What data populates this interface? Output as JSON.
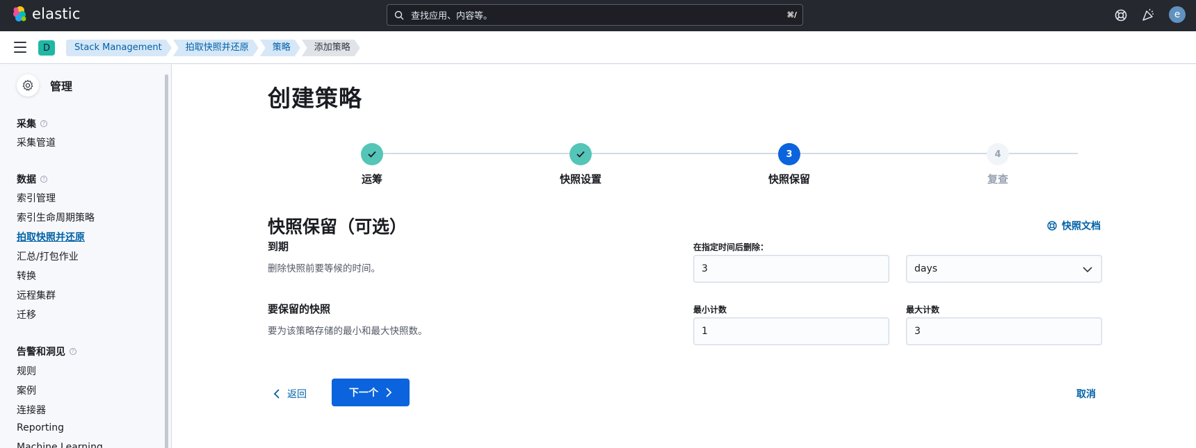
{
  "header": {
    "brand": "elastic",
    "search_placeholder": "查找应用、内容等。",
    "search_shortcut": "⌘/",
    "user_initial": "e"
  },
  "subbar": {
    "space_initial": "D",
    "breadcrumbs": [
      "Stack Management",
      "拍取快照并还原",
      "策略",
      "添加策略"
    ]
  },
  "sidebar": {
    "title": "管理",
    "sections": [
      {
        "label": "采集",
        "items": [
          "采集管道"
        ]
      },
      {
        "label": "数据",
        "items": [
          "索引管理",
          "索引生命周期策略",
          "拍取快照并还原",
          "汇总/打包作业",
          "转换",
          "远程集群",
          "迁移"
        ]
      },
      {
        "label": "告警和洞见",
        "items": [
          "规则",
          "案例",
          "连接器",
          "Reporting",
          "Machine Learning"
        ]
      }
    ],
    "active_item": "拍取快照并还原"
  },
  "main": {
    "title": "创建策略",
    "steps": [
      {
        "number": "1",
        "label": "运筹",
        "status": "complete"
      },
      {
        "number": "2",
        "label": "快照设置",
        "status": "complete"
      },
      {
        "number": "3",
        "label": "快照保留",
        "status": "current"
      },
      {
        "number": "4",
        "label": "复查",
        "status": "incomplete"
      }
    ],
    "section_title": "快照保留（可选）",
    "doc_link": "快照文档",
    "expiration": {
      "title": "到期",
      "description": "删除快照前要等候的时间。",
      "field_label": "在指定时间后删除：",
      "value": "3",
      "unit": "days"
    },
    "retain": {
      "title": "要保留的快照",
      "description": "要为该策略存储的最小和最大快照数。",
      "min_label": "最小计数",
      "min_value": "1",
      "max_label": "最大计数",
      "max_value": "3"
    },
    "buttons": {
      "back": "返回",
      "next": "下一个",
      "cancel": "取消"
    }
  },
  "colors": {
    "header_bg": "#25282f",
    "primary": "#0b64dd",
    "link": "#0061a6",
    "step_complete": "#54c5b7",
    "breadcrumb_bg": "#d6e7f7"
  }
}
